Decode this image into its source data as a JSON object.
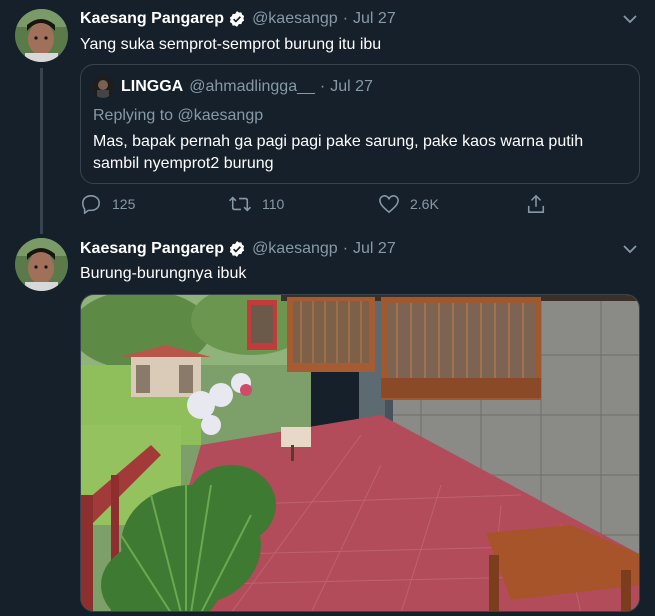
{
  "tweet1": {
    "name": "Kaesang Pangarep",
    "handle": "@kaesangp",
    "separator": "·",
    "date": "Jul 27",
    "text": "Yang suka semprot-semprot burung itu ibu",
    "quote": {
      "name": "LINGGA",
      "handle": "@ahmadlingga__",
      "separator": "·",
      "date": "Jul 27",
      "replying_to": "Replying to @kaesangp",
      "text": "Mas, bapak pernah ga pagi pagi pake sarung, pake kaos warna putih sambil nyemprot2 burung"
    },
    "actions": {
      "reply_count": "125",
      "retweet_count": "110",
      "like_count": "2.6K"
    }
  },
  "tweet2": {
    "name": "Kaesang Pangarep",
    "handle": "@kaesangp",
    "separator": "·",
    "date": "Jul 27",
    "text": "Burung-burungnya ibuk"
  },
  "icons": {
    "verified": "verified-badge-icon",
    "more": "chevron-down-icon",
    "reply": "reply-icon",
    "retweet": "retweet-icon",
    "like": "heart-icon",
    "share": "share-icon"
  },
  "colors": {
    "background": "#15202b",
    "muted": "#8899a6",
    "border": "#38444d",
    "verified": "#ffffff"
  }
}
